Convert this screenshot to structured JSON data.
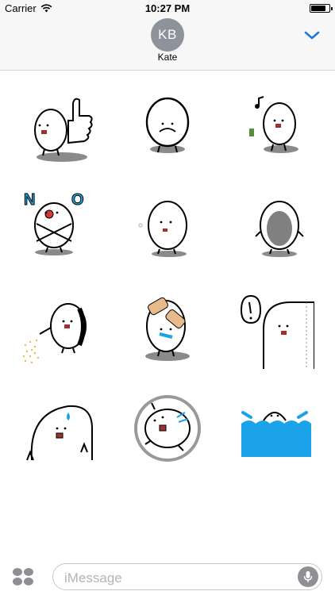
{
  "status": {
    "carrier": "Carrier",
    "time": "10:27 PM"
  },
  "header": {
    "avatar_initials": "KB",
    "contact_name": "Kate"
  },
  "stickers": [
    {
      "label": "egg-thumbs-up"
    },
    {
      "label": "egg-hands-clasped"
    },
    {
      "label": "egg-singing"
    },
    {
      "label": "egg-no-crossed-arms",
      "text": "N O"
    },
    {
      "label": "egg-sniffing"
    },
    {
      "label": "egg-gray-face"
    },
    {
      "label": "egg-spray"
    },
    {
      "label": "egg-bandaged-crying"
    },
    {
      "label": "egg-peeking-speech"
    },
    {
      "label": "egg-worried-sweat"
    },
    {
      "label": "egg-spinning"
    },
    {
      "label": "egg-drowning"
    }
  ],
  "composer": {
    "placeholder": "iMessage"
  },
  "colors": {
    "accent": "#1f7ae0",
    "avatar": "#8e929a",
    "water": "#1aa3e8"
  }
}
